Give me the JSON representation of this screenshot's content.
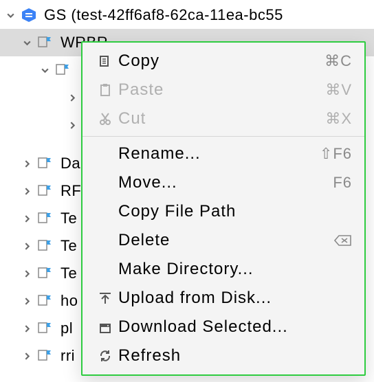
{
  "tree": {
    "root": {
      "label": "GS (test-42ff6af8-62ca-11ea-bc55"
    },
    "selected": {
      "label": "WRBR"
    },
    "children": [
      {
        "label": "Da"
      },
      {
        "label": "RF"
      },
      {
        "label": "Te"
      },
      {
        "label": "Te"
      },
      {
        "label": "Te"
      },
      {
        "label": "ho"
      },
      {
        "label": "pl"
      },
      {
        "label": "rri"
      }
    ]
  },
  "menu": {
    "copy": {
      "label": "Copy",
      "shortcut": "⌘C"
    },
    "paste": {
      "label": "Paste",
      "shortcut": "⌘V"
    },
    "cut": {
      "label": "Cut",
      "shortcut": "⌘X"
    },
    "rename": {
      "label": "Rename...",
      "shortcut": "⇧F6"
    },
    "move": {
      "label": "Move...",
      "shortcut": "F6"
    },
    "copy_path": {
      "label": "Copy File Path"
    },
    "delete": {
      "label": "Delete"
    },
    "make_dir": {
      "label": "Make Directory..."
    },
    "upload": {
      "label": "Upload from Disk..."
    },
    "download": {
      "label": "Download Selected..."
    },
    "refresh": {
      "label": "Refresh"
    }
  }
}
